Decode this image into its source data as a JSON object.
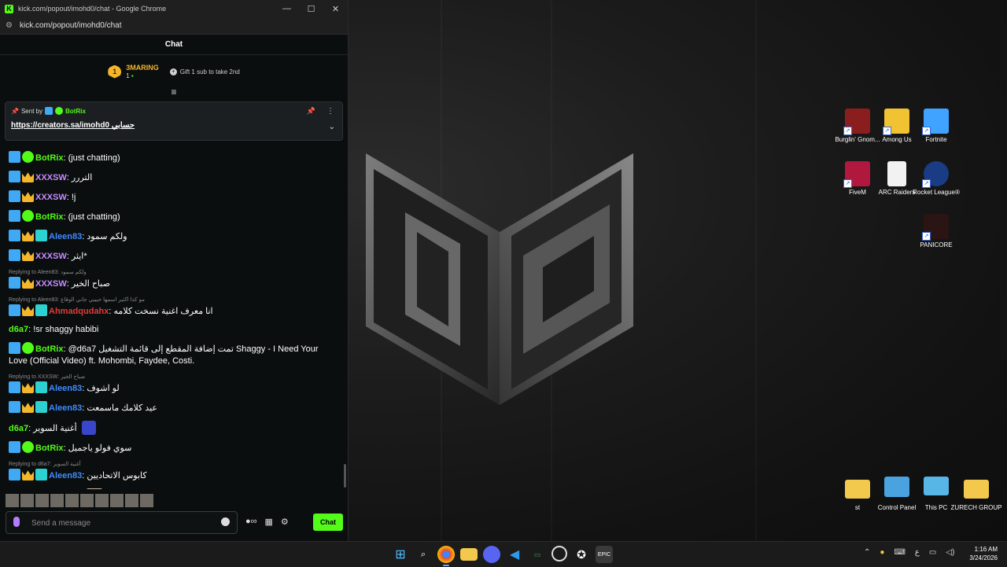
{
  "window": {
    "title": "kick.com/popout/imohd0/chat - Google Chrome",
    "url": "kick.com/popout/imohd0/chat",
    "controls": [
      "—",
      "☐",
      "✕"
    ]
  },
  "chat": {
    "header": "Chat",
    "leaderboard": {
      "rank": "1",
      "name": "3MARING",
      "count": "1",
      "gift_text": "Gift 1 sub to take 2nd"
    },
    "pinned": {
      "sent_by_label": "Sent by",
      "sender": "BotRix",
      "link_text": "https://creators.sa/imohd0",
      "link_suffix": "حسابي"
    },
    "messages": [
      {
        "type": "msg",
        "badges": [
          "mod",
          "verified"
        ],
        "user": "BotRix",
        "color": "green",
        "text": "(just chatting)"
      },
      {
        "type": "msg",
        "badges": [
          "mod",
          "crown"
        ],
        "user": "XXXSW",
        "color": "purple",
        "text": "التررر"
      },
      {
        "type": "msg",
        "badges": [
          "mod",
          "crown"
        ],
        "user": "XXXSW",
        "color": "purple",
        "text": "!j"
      },
      {
        "type": "msg",
        "badges": [
          "mod",
          "verified"
        ],
        "user": "BotRix",
        "color": "green",
        "text": "(just chatting)"
      },
      {
        "type": "msg",
        "badges": [
          "mod",
          "crown",
          "og"
        ],
        "user": "Aleen83",
        "color": "blue",
        "text": "ولكم سمود"
      },
      {
        "type": "msg",
        "badges": [
          "mod",
          "crown"
        ],
        "user": "XXXSW",
        "color": "purple",
        "text": "ايثر*"
      },
      {
        "type": "reply",
        "text": "Replying to Aleen83: ولكم سمود"
      },
      {
        "type": "msg",
        "badges": [
          "mod",
          "crown"
        ],
        "user": "XXXSW",
        "color": "purple",
        "text": "صباح الخير"
      },
      {
        "type": "reply",
        "text": "Replying to Aleen83: مو كذا اكثير اسمها حبيبي جاني الوقاع"
      },
      {
        "type": "msg",
        "badges": [
          "mod",
          "crown",
          "og"
        ],
        "user": "Ahmadqudahx",
        "color": "red",
        "text": "انا معرف اغنية نسخت كلامه"
      },
      {
        "type": "msg",
        "badges": [],
        "user": "d6a7",
        "color": "green",
        "text": "!sr shaggy habibi"
      },
      {
        "type": "msg",
        "badges": [
          "mod",
          "verified"
        ],
        "user": "BotRix",
        "color": "green",
        "text": "@d6a7 تمت إضافة المقطع إلى قائمة التشغيل Shaggy - I Need Your Love (Official Video) ft. Mohombi, Faydee, Costi."
      },
      {
        "type": "reply",
        "text": "Replying to XXXSW: صباح الخير"
      },
      {
        "type": "msg",
        "badges": [
          "mod",
          "crown",
          "og"
        ],
        "user": "Aleen83",
        "color": "blue",
        "text": "لو اشوف"
      },
      {
        "type": "msg",
        "badges": [
          "mod",
          "crown",
          "og"
        ],
        "user": "Aleen83",
        "color": "blue",
        "text": "عيد كلامك ماسمعت"
      },
      {
        "type": "msg",
        "badges": [],
        "user": "d6a7",
        "color": "green",
        "text": "أغنية السوير",
        "emote": true
      },
      {
        "type": "msg",
        "badges": [
          "mod",
          "verified"
        ],
        "user": "BotRix",
        "color": "green",
        "text": "سوي فولو ياجميل"
      },
      {
        "type": "reply",
        "text": "Replying to d6a7: أغنية السوير"
      },
      {
        "type": "msg",
        "badges": [
          "mod",
          "crown",
          "og"
        ],
        "user": "Aleen83",
        "color": "blue",
        "text": "كابوس الاتحاديين"
      },
      {
        "type": "msg",
        "badges": [
          "mod",
          "crown",
          "og"
        ],
        "user": "Aleen83",
        "color": "blue",
        "text": "",
        "avatar": true
      }
    ],
    "composer": {
      "placeholder": "Send a message",
      "send_label": "Chat"
    }
  },
  "desktop": {
    "icons": [
      {
        "label": "Burglin' Gnom...",
        "icon": "burglin-gnomes-icon",
        "color": "#8a1e1e"
      },
      {
        "label": "Among Us",
        "icon": "among-us-icon",
        "color": "#f1c232"
      },
      {
        "label": "Fortnite",
        "icon": "fortnite-icon",
        "color": "#3fa3ff"
      },
      {
        "label": "FiveM",
        "icon": "fivem-icon",
        "color": "#b0183d"
      },
      {
        "label": "ARC Raiders",
        "icon": "file-icon",
        "color": "#f2f2f2"
      },
      {
        "label": "Rocket League®",
        "icon": "rocket-league-icon",
        "color": "#1a3c84"
      },
      {
        "label": "PANICORE",
        "icon": "panicore-icon",
        "color": "#2b1414"
      },
      {
        "label": "st",
        "icon": "folder-icon",
        "color": "#f2c94c"
      },
      {
        "label": "Control Panel",
        "icon": "control-panel-icon",
        "color": "#4aa3df"
      },
      {
        "label": "This PC",
        "icon": "monitor-icon",
        "color": "#58b6e6"
      },
      {
        "label": "ZURECH GROUP",
        "icon": "folder-icon",
        "color": "#f2c94c"
      }
    ]
  },
  "taskbar": {
    "time": "1:16 AM",
    "date": "3/24/2026",
    "lang": "ع"
  }
}
